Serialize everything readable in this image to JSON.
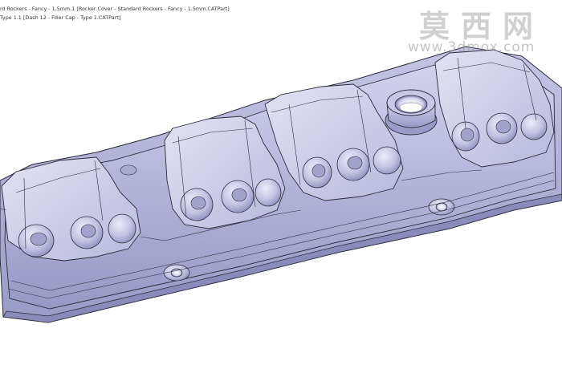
{
  "tree": {
    "lines": [
      "rd Rockers - Fancy - 1.5mm.1 [Rocker Cover - Standard Rockers - Fancy - 1.5mm.CATPart]",
      "Type 1.1 [Dash 12 - Filler Cap - Type 1.CATPart]"
    ]
  },
  "watermark": {
    "cn": "莫西网",
    "url": "www.3dmox.com"
  },
  "colors": {
    "part_base": "#b8b8dc",
    "part_light": "#dcdcf0",
    "part_shadow": "#8c8cbc",
    "edge_lines": "#2a2a3a",
    "background": "#ffffff"
  }
}
